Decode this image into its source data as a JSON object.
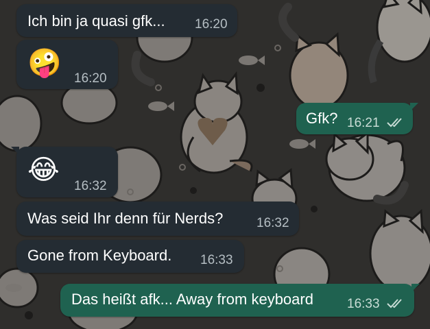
{
  "colors": {
    "background": "#2f2e2c",
    "incoming_bubble": "#242c33",
    "outgoing_bubble": "#1f6250",
    "read_ticks": "#c9ddd6"
  },
  "messages": [
    {
      "direction": "incoming",
      "text": "Ich bin ja quasi gfk...",
      "time": "16:20"
    },
    {
      "direction": "incoming",
      "emoji": "🤪",
      "time": "16:20"
    },
    {
      "direction": "outgoing",
      "text": "Gfk?",
      "time": "16:21",
      "status": "double-check-read"
    },
    {
      "direction": "incoming",
      "emoji": "😂",
      "time": "16:32"
    },
    {
      "direction": "incoming",
      "text": "Was seid Ihr denn für Nerds?",
      "time": "16:32"
    },
    {
      "direction": "incoming",
      "text": "Gone from Keyboard.",
      "time": "16:33"
    },
    {
      "direction": "outgoing",
      "text": "Das heißt afk... Away from keyboard",
      "time": "16:33",
      "status": "double-check-read"
    }
  ]
}
